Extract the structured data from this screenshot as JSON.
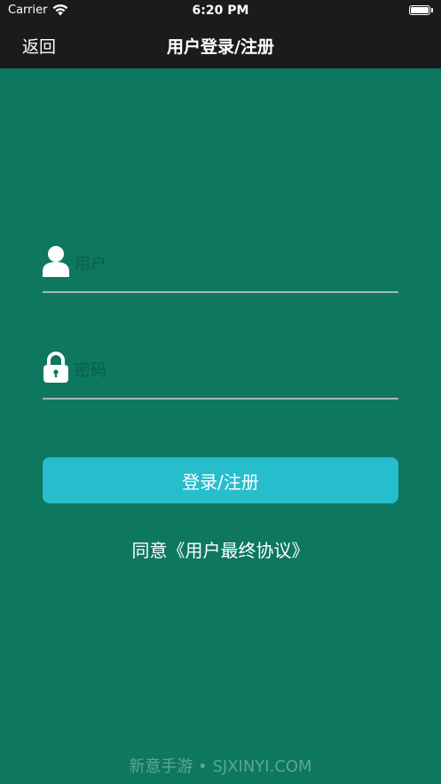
{
  "status_bar": {
    "carrier": "Carrier",
    "time": "6:20 PM",
    "battery_level": 1.0
  },
  "nav": {
    "back_label": "返回",
    "title": "用户登录/注册"
  },
  "form": {
    "username_placeholder": "用户",
    "password_placeholder": "密码",
    "submit_label": "登录/注册",
    "agreement_text": "同意《用户最终协议》"
  },
  "watermark": "新意手游 • SJXINYI.COM",
  "colors": {
    "background": "#0d7760",
    "nav_bar": "#1b1b1b",
    "button": "#26bdcd",
    "underline": "#a9b7b3"
  }
}
